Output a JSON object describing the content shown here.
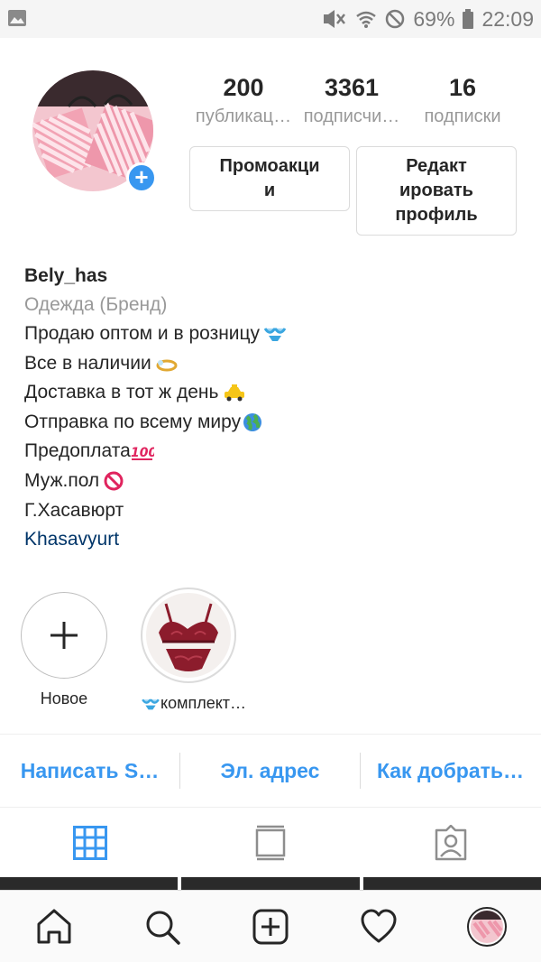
{
  "status_bar": {
    "battery": "69%",
    "time": "22:09"
  },
  "profile": {
    "stats": [
      {
        "value": "200",
        "label": "публикац…"
      },
      {
        "value": "3361",
        "label": "подписчи…"
      },
      {
        "value": "16",
        "label": "подписки"
      }
    ],
    "promo_button": "Промоакци\nи",
    "edit_button": "Редакт\nировать\nпрофиль"
  },
  "bio": {
    "username": "Bely_has",
    "category": "Одежда (Бренд)",
    "lines": [
      "Продаю оптом и в розницу",
      "Все в наличии",
      "Доставка в тот ж день",
      "Отправка по всему миру",
      "Предоплата",
      "Муж.пол",
      "Г.Хасавюрт"
    ],
    "location": "Khasavyurt"
  },
  "highlights": [
    {
      "label": "Новое"
    },
    {
      "label": "комплект…"
    }
  ],
  "actions": {
    "message": "Написать S…",
    "email": "Эл. адрес",
    "directions": "Как добрать…"
  },
  "colors": {
    "accent": "#3897f0",
    "location_link": "#003569",
    "muted": "#999999"
  }
}
